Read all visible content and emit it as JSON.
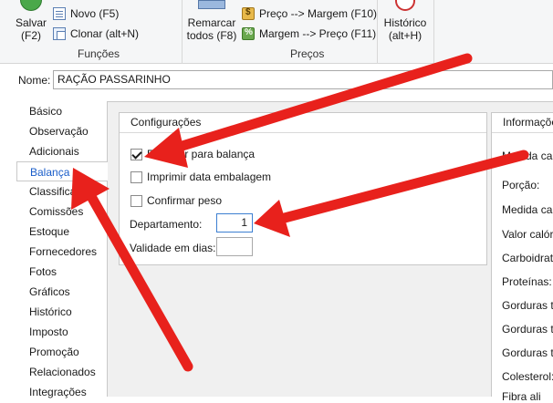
{
  "ribbon": {
    "save": {
      "label": "Salvar",
      "shortcut": "(F2)"
    },
    "novo": "Novo (F5)",
    "clonar": "Clonar (alt+N)",
    "funcoes_label": "Funções",
    "remarcar": {
      "label": "Remarcar",
      "shortcut": "todos (F8)"
    },
    "preco_margem": "Preço --> Margem (F10)",
    "margem_preco": "Margem --> Preço (F11)",
    "precos_label": "Preços",
    "historico": {
      "label": "Histórico",
      "shortcut": "(alt+H)"
    }
  },
  "product": {
    "name_label": "Nome:",
    "name_value": "RAÇÃO PASSARINHO"
  },
  "nav": {
    "items": [
      "Básico",
      "Observação",
      "Adicionais",
      "Balança",
      "Classificação",
      "Comissões",
      "Estoque",
      "Fornecedores",
      "Fotos",
      "Gráficos",
      "Histórico",
      "Imposto",
      "Promoção",
      "Relacionados",
      "Integrações"
    ],
    "selected": "Balança"
  },
  "config": {
    "title": "Configurações",
    "exportar": "Exportar para balança",
    "imprimir": "Imprimir data embalagem",
    "confirmar": "Confirmar peso",
    "departamento_label": "Departamento:",
    "departamento_value": "1",
    "validade_label": "Validade em dias:",
    "validade_value": ""
  },
  "info": {
    "title": "Informações",
    "rows": [
      "Medida ca",
      "Porção:",
      "Medida ca",
      "Valor calór",
      "Carboidrat",
      "Proteínas:",
      "Gorduras t",
      "Gorduras t",
      "Gorduras t",
      "Colesterol:",
      "Fibra ali"
    ]
  },
  "colors": {
    "accent": "#1a5dc9",
    "arrow": "#e8211c"
  }
}
